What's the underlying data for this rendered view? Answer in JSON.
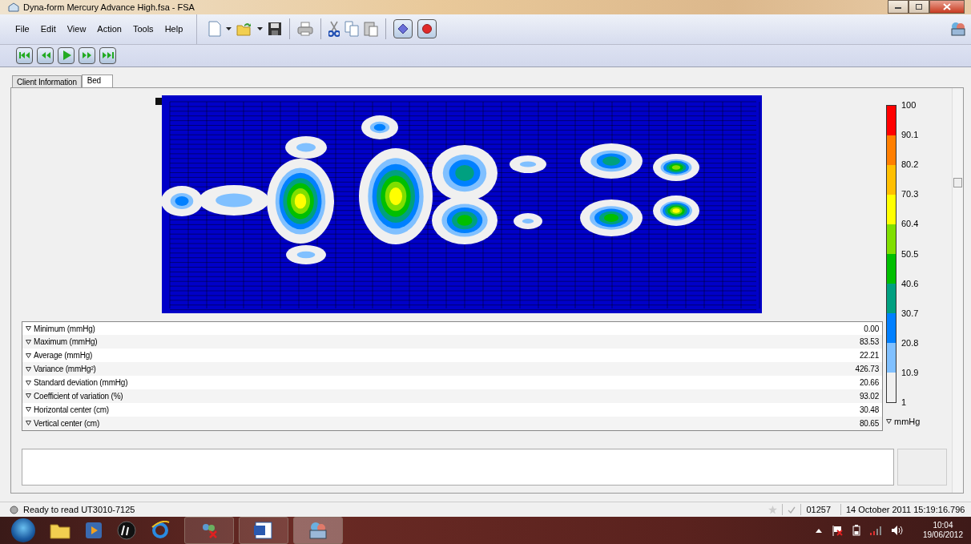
{
  "window": {
    "title": "Dyna-form Mercury Advance High.fsa - FSA"
  },
  "menu": [
    "File",
    "Edit",
    "View",
    "Action",
    "Tools",
    "Help"
  ],
  "tabs": [
    {
      "label": "Client Information",
      "selected": false
    },
    {
      "label": "Bed",
      "selected": true
    }
  ],
  "statistics": [
    {
      "label": "Minimum (mmHg)",
      "value": "0.00"
    },
    {
      "label": "Maximum (mmHg)",
      "value": "83.53"
    },
    {
      "label": "Average (mmHg)",
      "value": "22.21"
    },
    {
      "label": "Variance (mmHg²)",
      "value": "426.73"
    },
    {
      "label": "Standard deviation (mmHg)",
      "value": "20.66"
    },
    {
      "label": "Coefficient of variation (%)",
      "value": "93.02"
    },
    {
      "label": "Horizontal center (cm)",
      "value": "30.48"
    },
    {
      "label": "Vertical center (cm)",
      "value": "80.65"
    }
  ],
  "legend": {
    "ticks": [
      "100",
      "90.1",
      "80.2",
      "70.3",
      "60.4",
      "50.5",
      "40.6",
      "30.7",
      "20.8",
      "10.9",
      "1"
    ],
    "bands": [
      {
        "color": "#ff0000"
      },
      {
        "color": "#ff7f00"
      },
      {
        "color": "#ffbf00"
      },
      {
        "color": "#ffff00"
      },
      {
        "color": "#80df00"
      },
      {
        "color": "#00bf00"
      },
      {
        "color": "#00a080"
      },
      {
        "color": "#0080ff"
      },
      {
        "color": "#80c0ff"
      },
      {
        "color": "#f0f0f0"
      }
    ],
    "unit": "mmHg"
  },
  "status_bar": {
    "message": "Ready to read UT3010-7125",
    "code": "01257",
    "timestamp": "14 October 2011 15:19:16.796"
  },
  "taskbar": {
    "time": "10:04",
    "date": "19/06/2012"
  }
}
